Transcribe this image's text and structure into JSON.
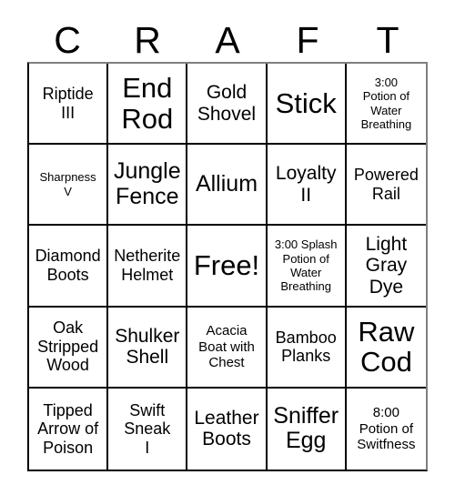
{
  "card": {
    "title_letters": [
      "C",
      "R",
      "A",
      "F",
      "T"
    ],
    "columns": 5,
    "rows": 5,
    "free_space_label": "Free!",
    "colors": {
      "background": "#ffffff",
      "text": "#000000",
      "grid_line": "#000000"
    },
    "cells": [
      [
        {
          "text": "Riptide\nIII",
          "size": "md"
        },
        {
          "text": "End\nRod",
          "size": "xxl"
        },
        {
          "text": "Gold\nShovel",
          "size": "lg"
        },
        {
          "text": "Stick",
          "size": "xxl"
        },
        {
          "text": "3:00\nPotion of\nWater\nBreathing",
          "size": "xs"
        }
      ],
      [
        {
          "text": "Sharpness\nV",
          "size": "xs"
        },
        {
          "text": "Jungle\nFence",
          "size": "xl"
        },
        {
          "text": "Allium",
          "size": "xl"
        },
        {
          "text": "Loyalty\nII",
          "size": "lg"
        },
        {
          "text": "Powered\nRail",
          "size": "md"
        }
      ],
      [
        {
          "text": "Diamond\nBoots",
          "size": "md"
        },
        {
          "text": "Netherite\nHelmet",
          "size": "md"
        },
        {
          "text": "Free!",
          "size": "xxl"
        },
        {
          "text": "3:00 Splash\nPotion of\nWater\nBreathing",
          "size": "xs"
        },
        {
          "text": "Light\nGray\nDye",
          "size": "lg"
        }
      ],
      [
        {
          "text": "Oak\nStripped\nWood",
          "size": "md"
        },
        {
          "text": "Shulker\nShell",
          "size": "lg"
        },
        {
          "text": "Acacia\nBoat with\nChest",
          "size": "sm"
        },
        {
          "text": "Bamboo\nPlanks",
          "size": "md"
        },
        {
          "text": "Raw\nCod",
          "size": "xxl"
        }
      ],
      [
        {
          "text": "Tipped\nArrow of\nPoison",
          "size": "md"
        },
        {
          "text": "Swift\nSneak\nI",
          "size": "md"
        },
        {
          "text": "Leather\nBoots",
          "size": "lg"
        },
        {
          "text": "Sniffer\nEgg",
          "size": "xl"
        },
        {
          "text": "8:00\nPotion of\nSwitfness",
          "size": "sm"
        }
      ]
    ]
  }
}
